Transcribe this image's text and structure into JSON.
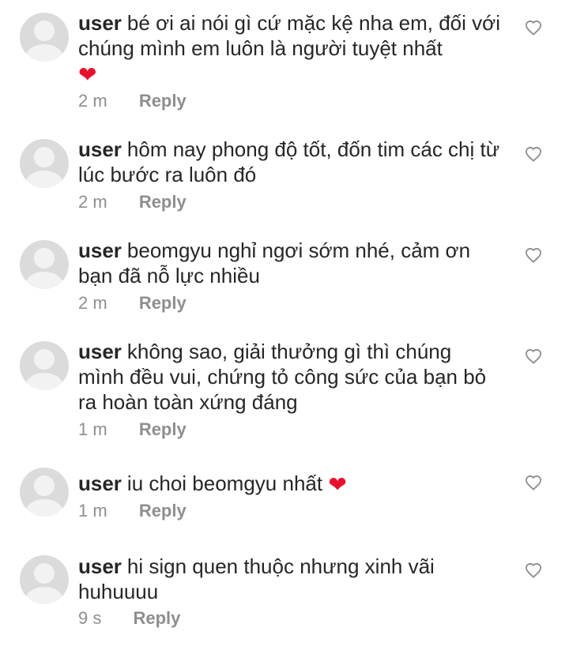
{
  "comments": [
    {
      "username": "user",
      "text": "bé ơi ai nói gì cứ mặc kệ nha em, đối với chúng mình em luôn là người tuyệt nhất",
      "emoji": "❤",
      "time": "2 m",
      "reply_label": "Reply",
      "icon": "heart-outline-icon"
    },
    {
      "username": "user",
      "text": "hôm nay phong độ tốt, đốn tim các chị từ lúc bước ra luôn đó",
      "time": "2 m",
      "reply_label": "Reply",
      "icon": "heart-outline-icon"
    },
    {
      "username": "user",
      "text": "beomgyu nghỉ ngơi sớm nhé, cảm ơn bạn đã nỗ lực nhiều",
      "time": "2 m",
      "reply_label": "Reply",
      "icon": "heart-outline-icon"
    },
    {
      "username": "user",
      "text": "không sao, giải thưởng gì thì chúng mình đều vui, chứng tỏ công sức của bạn bỏ ra hoàn toàn xứng đáng",
      "time": "1 m",
      "reply_label": "Reply",
      "icon": "heart-outline-icon"
    },
    {
      "username": "user",
      "text": "iu choi beomgyu nhất",
      "emoji": "❤",
      "time": "1 m",
      "reply_label": "Reply",
      "icon": "heart-outline-icon"
    },
    {
      "username": "user",
      "text": "hi sign quen thuộc nhưng xinh vãi huhuuuu",
      "time": "9 s",
      "reply_label": "Reply",
      "icon": "heart-outline-icon"
    }
  ],
  "colors": {
    "text": "#262626",
    "secondary": "#8e8e8e",
    "avatar": "#dbdbdb",
    "emoji_heart": "#e8112d"
  }
}
